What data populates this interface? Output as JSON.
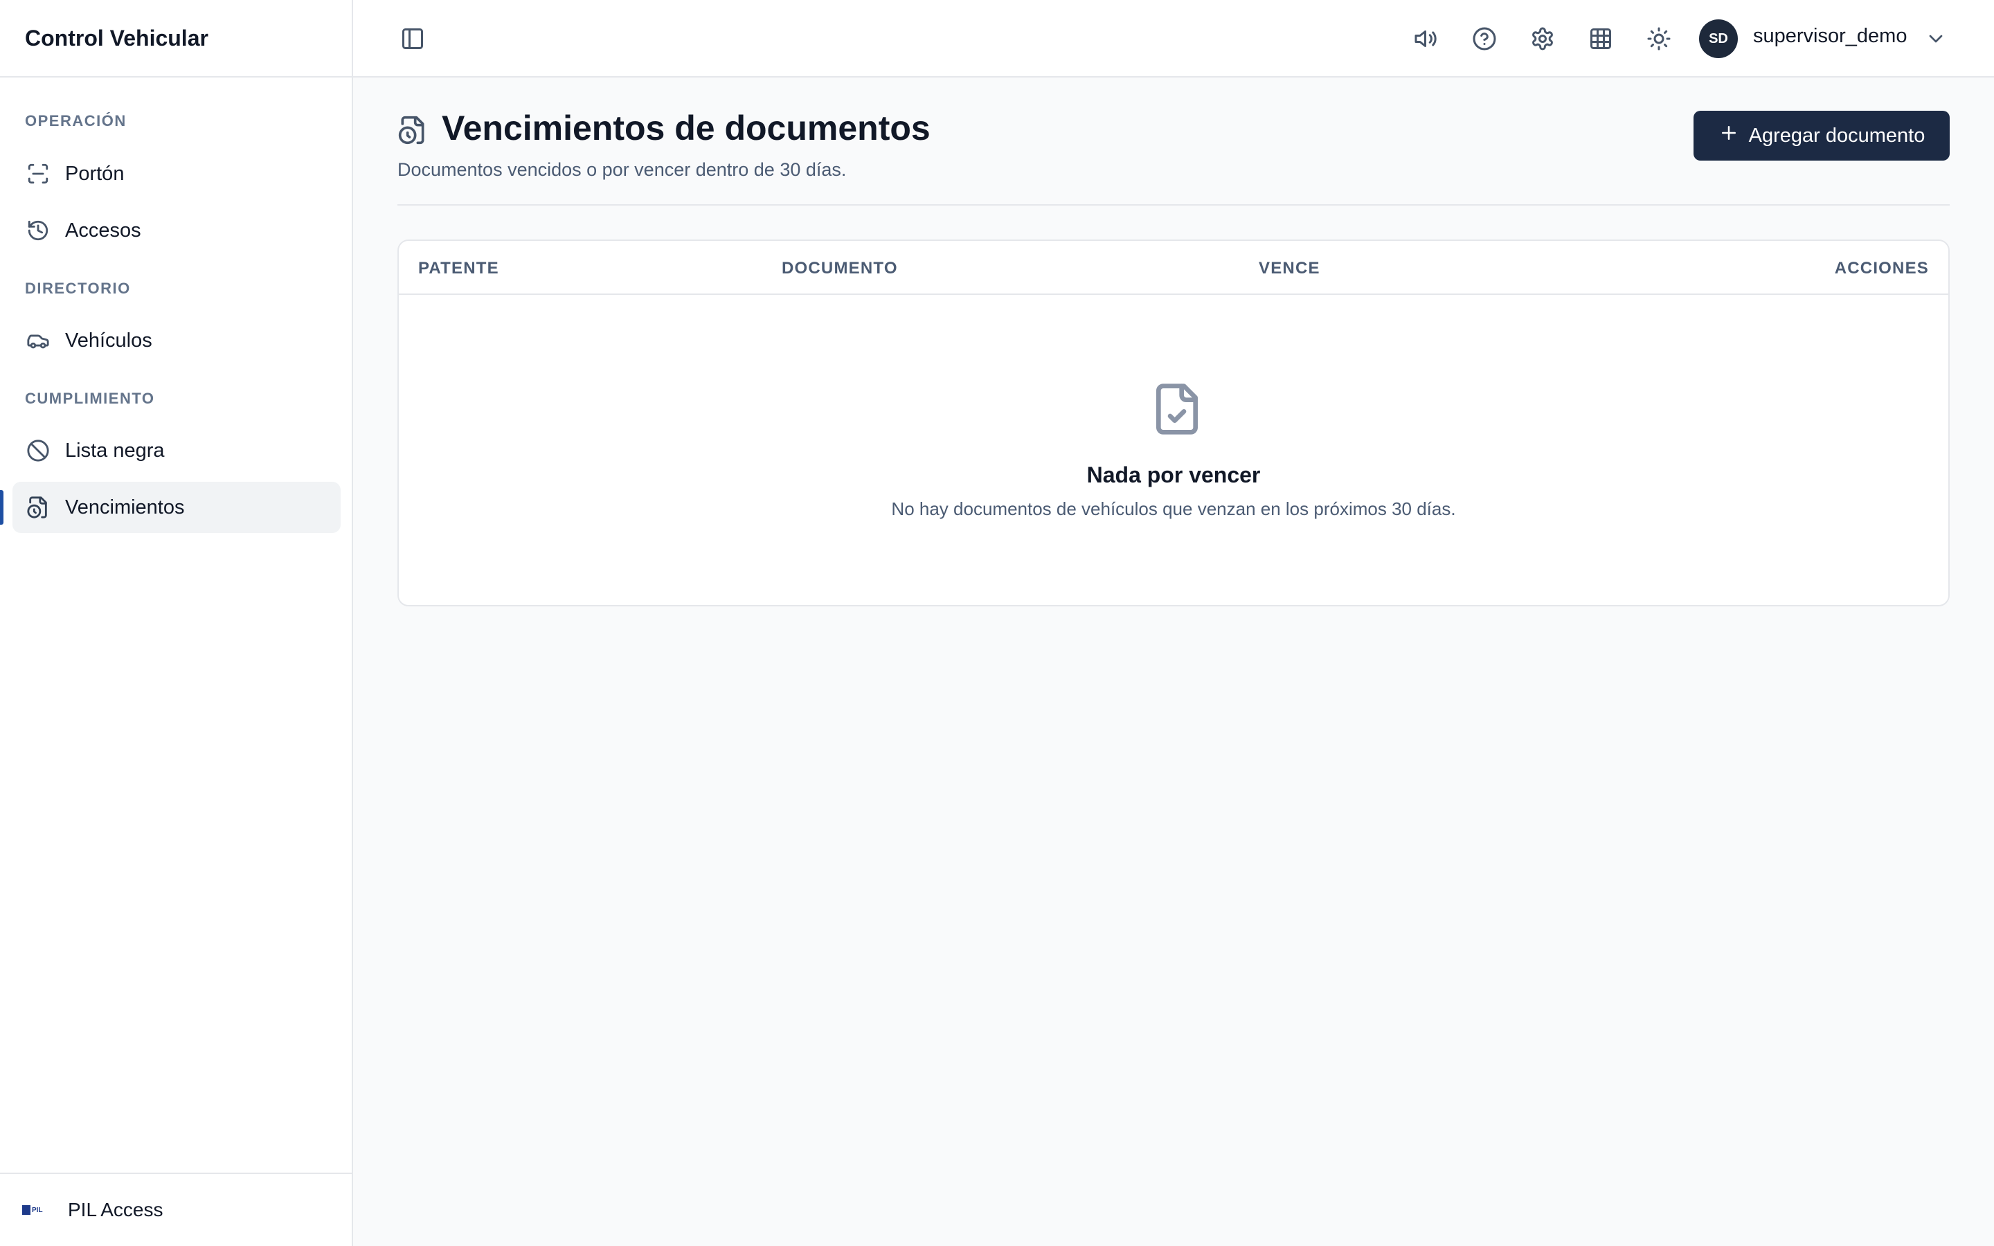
{
  "app": {
    "title": "Control Vehicular"
  },
  "sidebar": {
    "sections": [
      {
        "label": "OPERACIÓN",
        "items": [
          {
            "label": "Portón",
            "icon": "scan-icon"
          },
          {
            "label": "Accesos",
            "icon": "history-icon"
          }
        ]
      },
      {
        "label": "DIRECTORIO",
        "items": [
          {
            "label": "Vehículos",
            "icon": "car-icon"
          }
        ]
      },
      {
        "label": "CUMPLIMIENTO",
        "items": [
          {
            "label": "Lista negra",
            "icon": "ban-icon"
          },
          {
            "label": "Vencimientos",
            "icon": "file-clock-icon",
            "active": true
          }
        ]
      }
    ],
    "footer": {
      "label": "PIL Access",
      "logo_text": "PIL"
    }
  },
  "topbar": {
    "icons": [
      "sidebar-toggle-icon",
      "speaker-icon",
      "help-icon",
      "settings-icon",
      "grid-icon",
      "sun-icon"
    ],
    "user": {
      "initials": "SD",
      "name": "supervisor_demo"
    }
  },
  "page": {
    "title": "Vencimientos de documentos",
    "subtitle": "Documentos vencidos o por vencer dentro de 30 días.",
    "add_button": "Agregar documento"
  },
  "table": {
    "columns": [
      "PATENTE",
      "DOCUMENTO",
      "VENCE",
      "ACCIONES"
    ],
    "empty": {
      "title": "Nada por vencer",
      "message": "No hay documentos de vehículos que venzan en los próximos 30 días."
    }
  },
  "colors": {
    "accent": "#1e4fa3",
    "primary_button": "#1c2a44",
    "avatar": "#1e293b"
  }
}
